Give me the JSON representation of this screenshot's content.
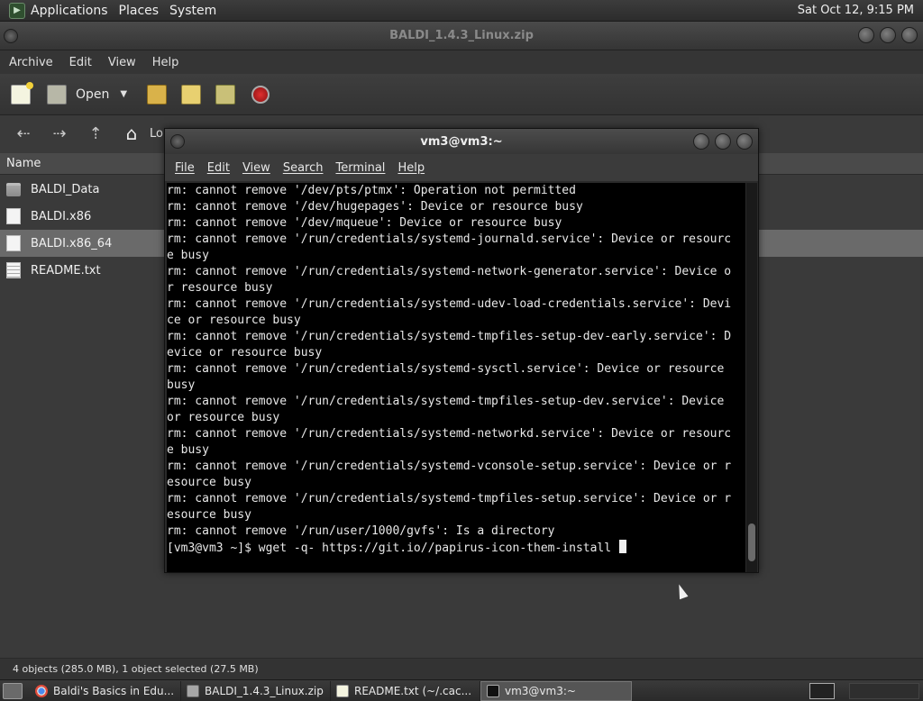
{
  "top_panel": {
    "menus": [
      "Applications",
      "Places",
      "System"
    ],
    "clock": "Sat Oct 12,  9:15 PM"
  },
  "archive_window": {
    "title": "BALDI_1.4.3_Linux.zip",
    "menus": [
      "Archive",
      "Edit",
      "View",
      "Help"
    ],
    "toolbar": {
      "open_label": "Open"
    },
    "location_label": "Lo",
    "column_header": "Name",
    "files": [
      {
        "name": "BALDI_Data",
        "icon": "folder-icon"
      },
      {
        "name": "BALDI.x86",
        "icon": "file-icon"
      },
      {
        "name": "BALDI.x86_64",
        "icon": "file-icon",
        "selected": true
      },
      {
        "name": "README.txt",
        "icon": "text-file-icon"
      }
    ],
    "status": "4 objects (285.0 MB), 1 object selected (27.5 MB)"
  },
  "terminal": {
    "title": "vm3@vm3:~",
    "menus": [
      "File",
      "Edit",
      "View",
      "Search",
      "Terminal",
      "Help"
    ],
    "lines": [
      "rm: cannot remove '/dev/pts/ptmx': Operation not permitted",
      "rm: cannot remove '/dev/hugepages': Device or resource busy",
      "rm: cannot remove '/dev/mqueue': Device or resource busy",
      "rm: cannot remove '/run/credentials/systemd-journald.service': Device or resourc",
      "e busy",
      "rm: cannot remove '/run/credentials/systemd-network-generator.service': Device o",
      "r resource busy",
      "rm: cannot remove '/run/credentials/systemd-udev-load-credentials.service': Devi",
      "ce or resource busy",
      "rm: cannot remove '/run/credentials/systemd-tmpfiles-setup-dev-early.service': D",
      "evice or resource busy",
      "rm: cannot remove '/run/credentials/systemd-sysctl.service': Device or resource",
      "busy",
      "rm: cannot remove '/run/credentials/systemd-tmpfiles-setup-dev.service': Device",
      "or resource busy",
      "rm: cannot remove '/run/credentials/systemd-networkd.service': Device or resourc",
      "e busy",
      "rm: cannot remove '/run/credentials/systemd-vconsole-setup.service': Device or r",
      "esource busy",
      "rm: cannot remove '/run/credentials/systemd-tmpfiles-setup.service': Device or r",
      "esource busy",
      "rm: cannot remove '/run/user/1000/gvfs': Is a directory"
    ],
    "prompt": "[vm3@vm3 ~]$ wget -q- https://git.io//papirus-icon-them-install "
  },
  "taskbar": {
    "tasks": [
      {
        "label": "Baldi's Basics in Edu...",
        "icon": "chrome-icon"
      },
      {
        "label": "BALDI_1.4.3_Linux.zip",
        "icon": "archive-icon"
      },
      {
        "label": "README.txt (~/.cac...",
        "icon": "text-editor-icon"
      },
      {
        "label": "vm3@vm3:~",
        "icon": "terminal-icon",
        "active": true
      }
    ]
  }
}
